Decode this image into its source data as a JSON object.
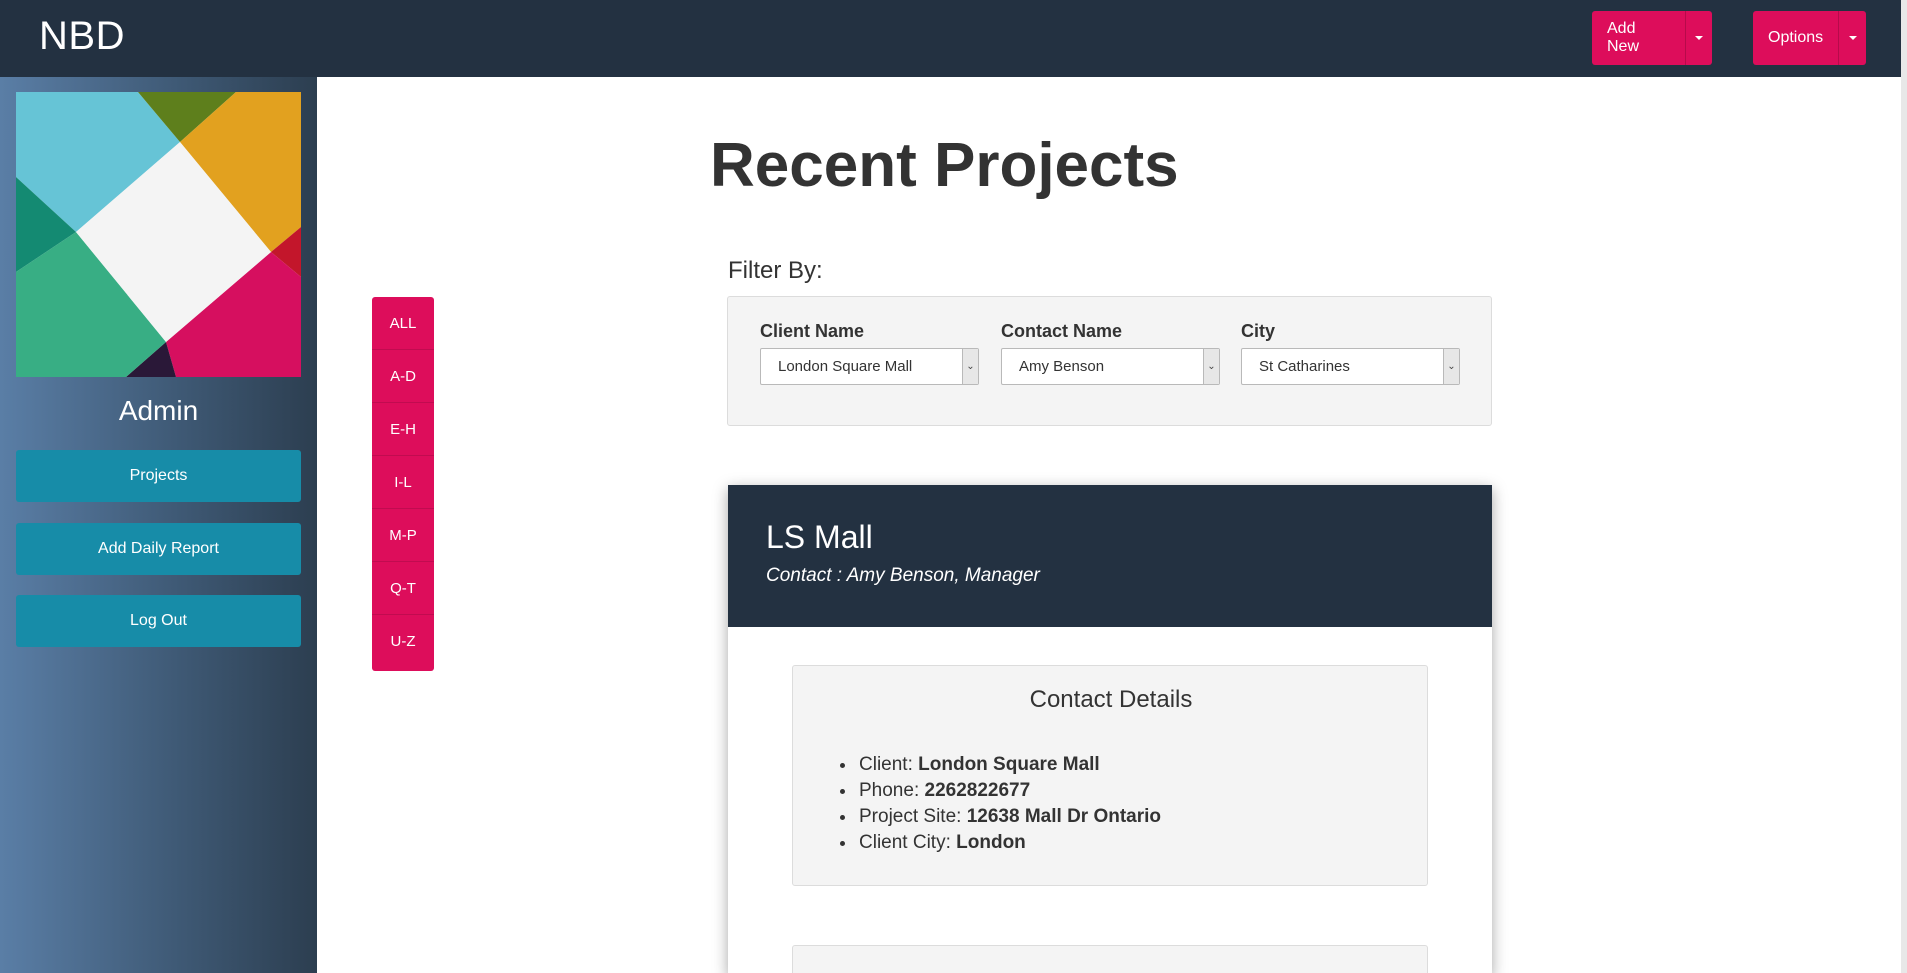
{
  "navbar": {
    "brand": "NBD",
    "add_new_label": "Add New",
    "options_label": "Options",
    "accent_color": "#dd0d5b",
    "bg_color": "#233141"
  },
  "sidebar": {
    "user_name": "Admin",
    "buttons": [
      {
        "label": "Projects"
      },
      {
        "label": "Add Daily Report"
      },
      {
        "label": "Log Out"
      }
    ]
  },
  "main": {
    "title": "Recent Projects",
    "alpha_filter": [
      "ALL",
      "A-D",
      "E-H",
      "I-L",
      "M-P",
      "Q-T",
      "U-Z"
    ],
    "filter": {
      "heading": "Filter By:",
      "fields": [
        {
          "label": "Client Name",
          "value": "London Square Mall"
        },
        {
          "label": "Contact Name",
          "value": "Amy Benson"
        },
        {
          "label": "City",
          "value": "St Catharines"
        }
      ]
    },
    "project": {
      "name": "LS Mall",
      "contact_line": "Contact : Amy Benson, Manager",
      "details_title": "Contact Details",
      "details": [
        {
          "label": "Client: ",
          "value": "London Square Mall"
        },
        {
          "label": "Phone: ",
          "value": "2262822677"
        },
        {
          "label": "Project Site: ",
          "value": "12638 Mall Dr Ontario"
        },
        {
          "label": "Client City: ",
          "value": "London"
        }
      ]
    }
  }
}
